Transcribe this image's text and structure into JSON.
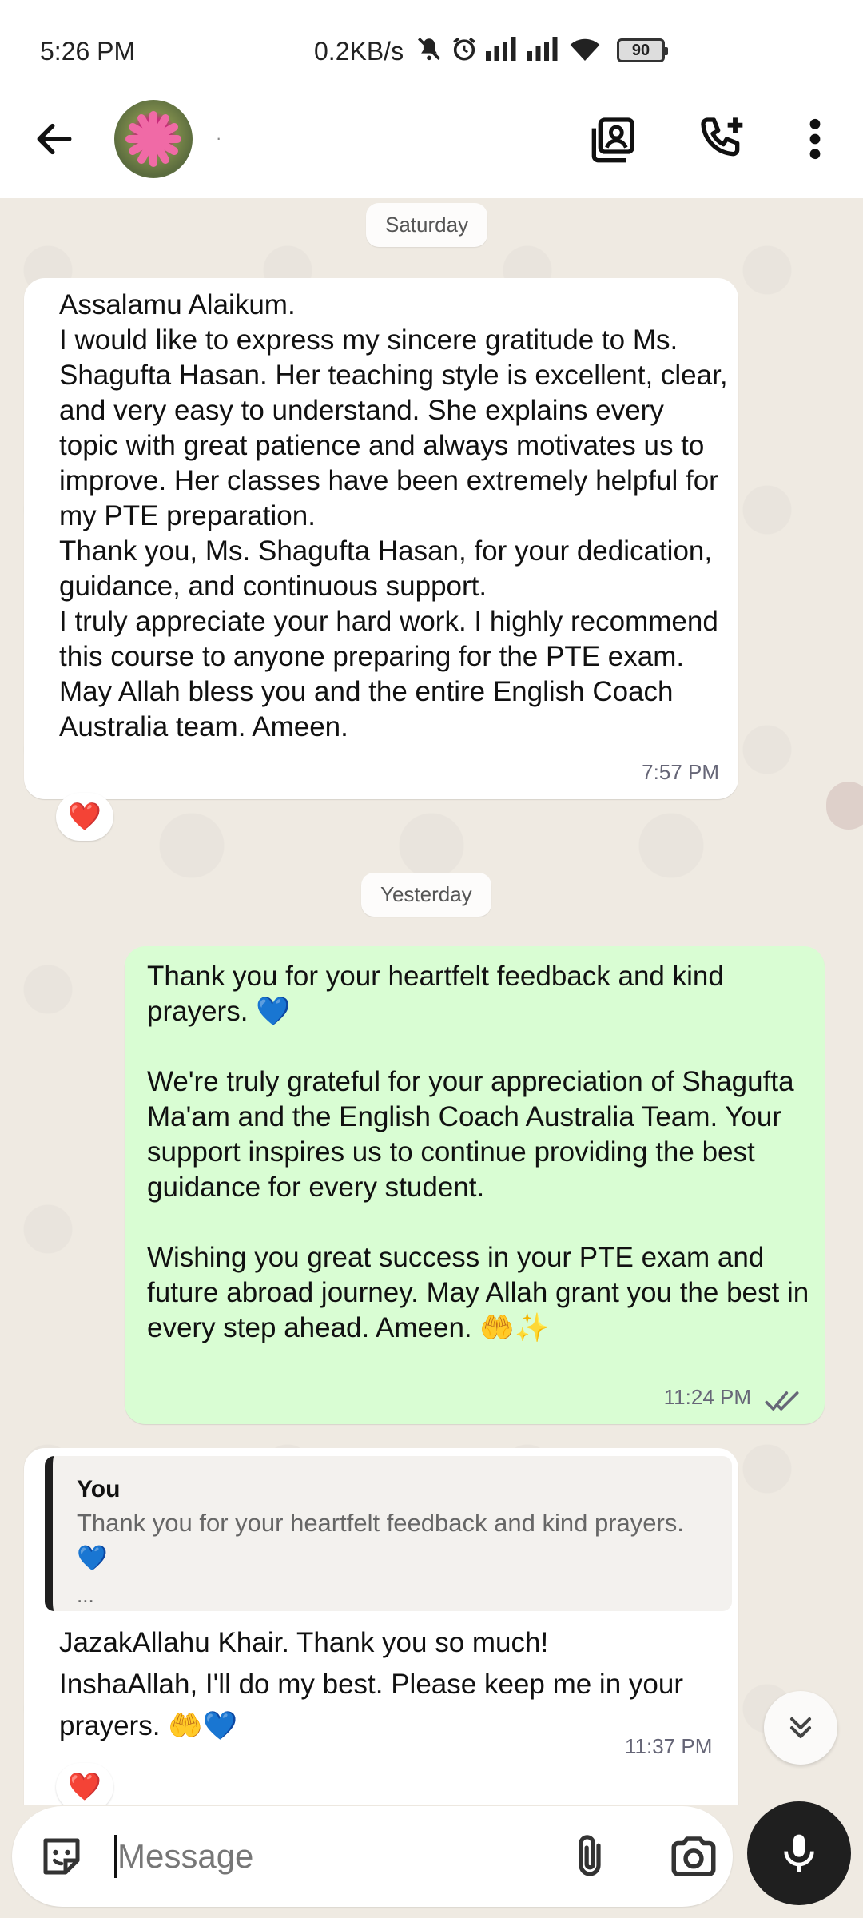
{
  "status_bar": {
    "time": "5:26 PM",
    "network_speed": "0.2KB/s",
    "battery": "90",
    "icons": [
      "mute-icon",
      "alarm-icon",
      "signal-icon",
      "signal-icon",
      "wifi-icon",
      "battery-icon"
    ]
  },
  "header": {
    "contact_name": "·",
    "icons": [
      "back-arrow-icon",
      "contact-card-icon",
      "add-call-icon",
      "more-vert-icon"
    ]
  },
  "chat": {
    "date_1": "Saturday",
    "date_2": "Yesterday",
    "message_1": {
      "text": "Assalamu Alaikum.\nI would like to express my sincere gratitude to Ms. Shagufta Hasan. Her teaching style is excellent, clear, and very easy to understand. She explains every topic with great patience and always motivates us to improve. Her classes have been extremely helpful for my PTE preparation.\nThank you, Ms. Shagufta Hasan, for your dedication, guidance, and continuous support.\nI truly appreciate your hard work. I highly recommend this course to anyone preparing for the PTE exam.\nMay Allah bless you and the entire English Coach Australia team. Ameen.",
      "time": "7:57 PM",
      "reaction": "❤️"
    },
    "message_2": {
      "text": "Thank you for your heartfelt feedback and kind prayers. 💙\n\nWe're truly grateful for your appreciation of Shagufta Ma'am and the English Coach Australia Team. Your support inspires us to continue providing the best guidance for every student.\n\nWishing you great success in your PTE exam and future abroad journey. May Allah grant you the best in every step ahead. Ameen. 🤲✨",
      "time": "11:24 PM",
      "status_icon": "double-check-icon"
    },
    "message_3": {
      "quote_author": "You",
      "quote_text": "Thank you for your heartfelt feedback and kind prayers. 💙",
      "quote_more": "...",
      "text": "JazakAllahu Khair. Thank you so much!\nInshaAllah, I'll do my best. Please keep me in your prayers. 🤲💙",
      "time": "11:37 PM",
      "reaction": "❤️"
    }
  },
  "composer": {
    "placeholder": "Message",
    "icons": [
      "sticker-icon",
      "attach-icon",
      "camera-icon",
      "mic-icon"
    ]
  },
  "colors": {
    "chat_background": "#efeae2",
    "outgoing_bubble": "#d9fdd3",
    "incoming_bubble": "#ffffff",
    "mic_button": "#1f1f1f"
  }
}
